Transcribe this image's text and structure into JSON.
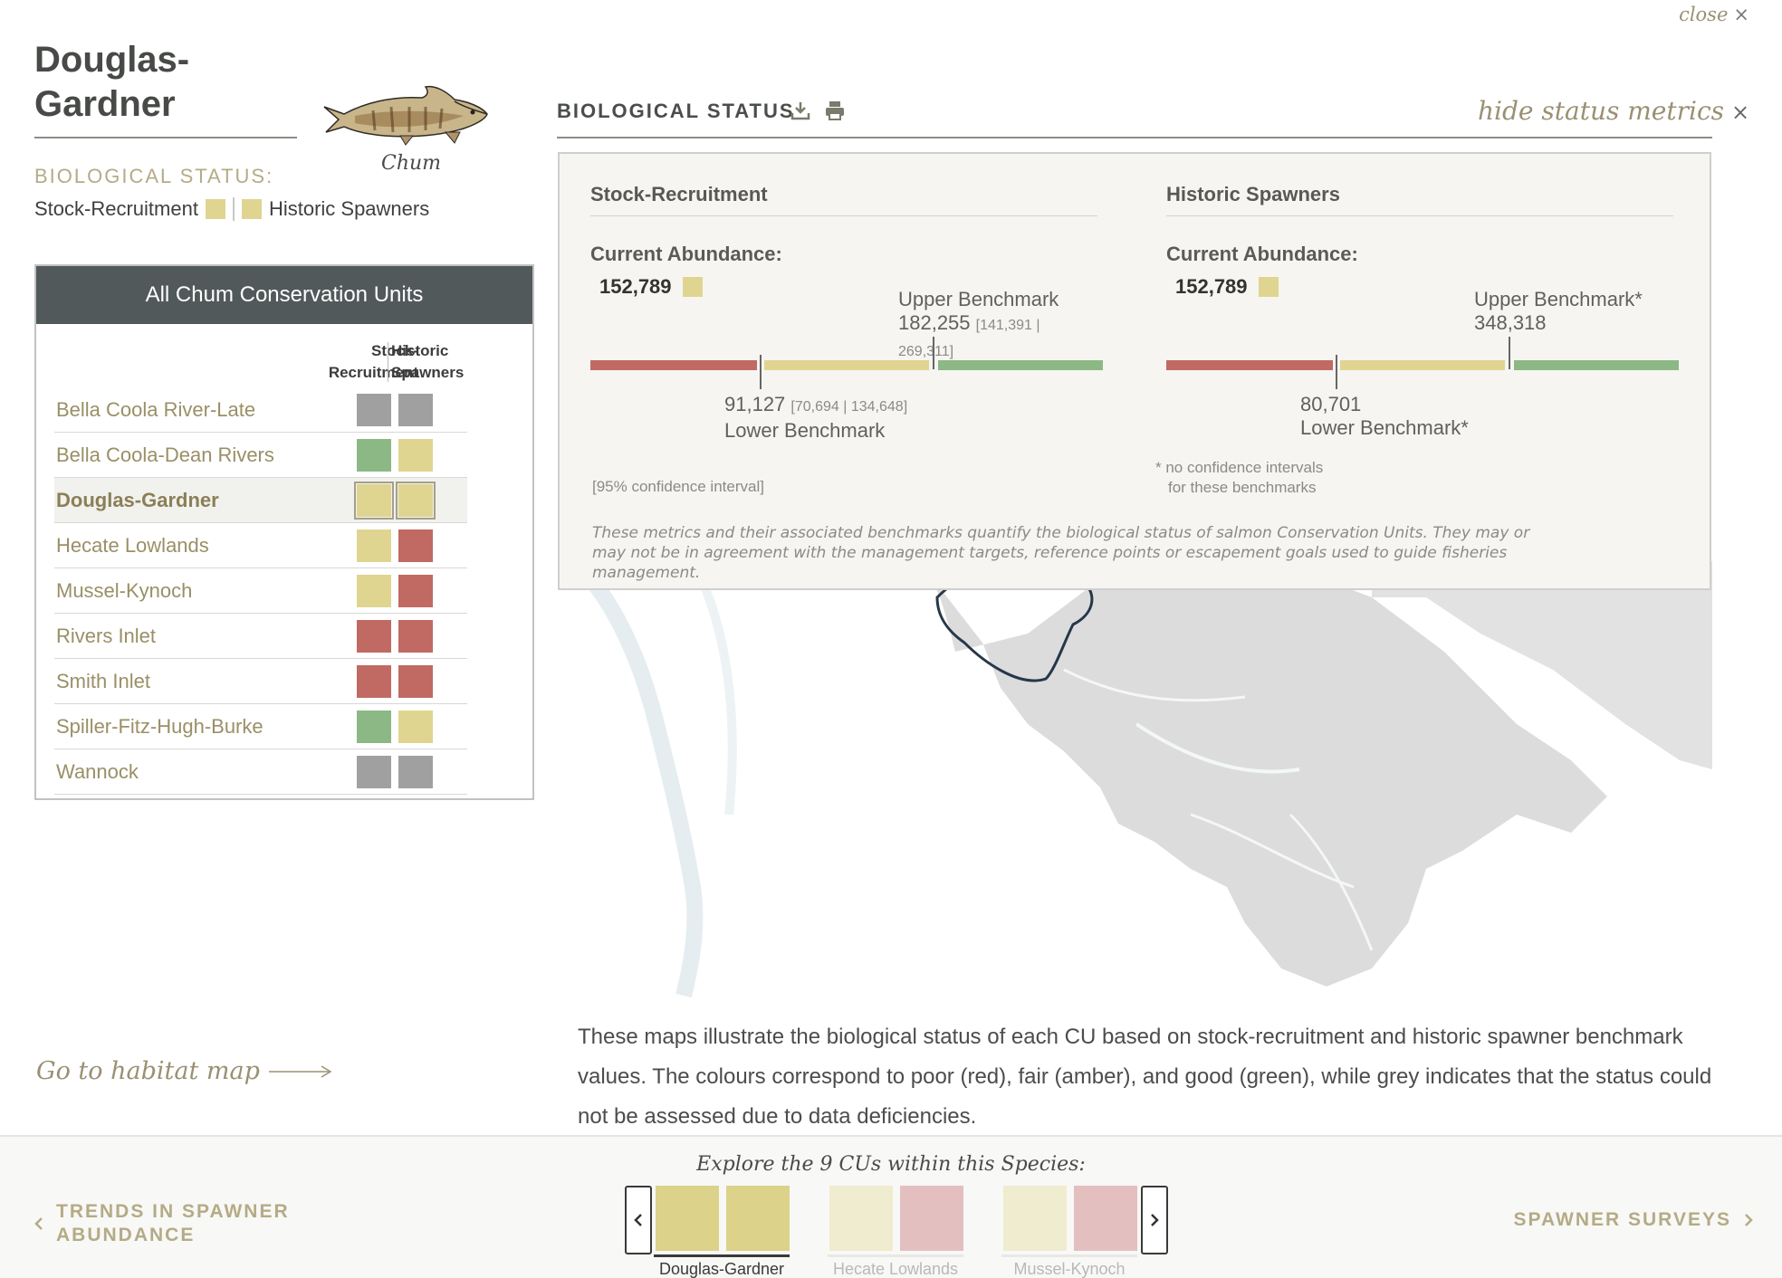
{
  "header": {
    "close_label": "close",
    "close_x": "×",
    "title": "Douglas-Gardner",
    "species": "Chum"
  },
  "left": {
    "bio_status_label": "BIOLOGICAL STATUS:",
    "legend_sr": "Stock-Recruitment",
    "legend_hs": "Historic Spawners",
    "panel_title": "All Chum Conservation Units",
    "col_sr": "Stock-Recruitment",
    "col_sr_line1": "Stock-",
    "col_sr_line2": "Recruitment",
    "col_hs_line1": "Historic",
    "col_hs_line2": "Spawners",
    "units": [
      {
        "name": "Bella Coola River-Late",
        "sr": "grey",
        "hs": "grey"
      },
      {
        "name": "Bella Coola-Dean Rivers",
        "sr": "green",
        "hs": "amber"
      },
      {
        "name": "Douglas-Gardner",
        "sr": "amber",
        "hs": "amber",
        "selected": true
      },
      {
        "name": "Hecate Lowlands",
        "sr": "amber",
        "hs": "red"
      },
      {
        "name": "Mussel-Kynoch",
        "sr": "amber",
        "hs": "red"
      },
      {
        "name": "Rivers Inlet",
        "sr": "red",
        "hs": "red"
      },
      {
        "name": "Smith Inlet",
        "sr": "red",
        "hs": "red"
      },
      {
        "name": "Spiller-Fitz-Hugh-Burke",
        "sr": "green",
        "hs": "amber"
      },
      {
        "name": "Wannock",
        "sr": "grey",
        "hs": "grey"
      }
    ],
    "habitat_link": "Go to habitat map"
  },
  "status_colors": {
    "grey": "#a0a0a0",
    "green": "#8cb886",
    "amber": "#dfd591",
    "red": "#c06a63"
  },
  "metrics": {
    "section_label": "BIOLOGICAL STATUS",
    "hide_label": "hide status metrics",
    "stock_recruitment": {
      "title": "Stock-Recruitment",
      "current_label": "Current Abundance:",
      "current_value": "152,789",
      "upper_label": "Upper Benchmark",
      "upper_value": "182,255",
      "upper_ci": "[141,391 | 269,311]",
      "lower_value": "91,127",
      "lower_ci": "[70,694 | 134,648]",
      "lower_label": "Lower Benchmark"
    },
    "historic_spawners": {
      "title": "Historic Spawners",
      "current_label": "Current Abundance:",
      "current_value": "152,789",
      "upper_label": "Upper Benchmark*",
      "upper_value": "348,318",
      "lower_value": "80,701",
      "lower_label": "Lower Benchmark*"
    },
    "ci_note": "[95% confidence interval]",
    "no_ci_note_line1": "* no confidence intervals",
    "no_ci_note_line2": "for these benchmarks",
    "disclaimer": "These metrics and their associated benchmarks quantify the biological status of salmon Conservation Units. They may or may not be in agreement with the management targets, reference points or escapement goals used to guide fisheries management."
  },
  "description": "These maps illustrate the biological status of each CU based on stock-recruitment and historic spawner benchmark values. The colours correspond to poor (red), fair (amber), and good (green), while grey indicates that the status could not be assessed due to data deficiencies.",
  "bottom_nav": {
    "prev_line1": "TRENDS IN SPAWNER",
    "prev_line2": "ABUNDANCE",
    "next_label": "SPAWNER SURVEYS",
    "explore_label": "Explore the 9 CUs within this Species:",
    "carousel": [
      {
        "name": "Douglas-Gardner",
        "sr_color": "#dcd28a",
        "hs_color": "#dcd28a",
        "active": true
      },
      {
        "name": "Hecate Lowlands",
        "sr_color": "#efeccf",
        "hs_color": "#e3bfbf",
        "active": false
      },
      {
        "name": "Mussel-Kynoch",
        "sr_color": "#efeccf",
        "hs_color": "#e3bfbf",
        "active": false
      }
    ]
  }
}
